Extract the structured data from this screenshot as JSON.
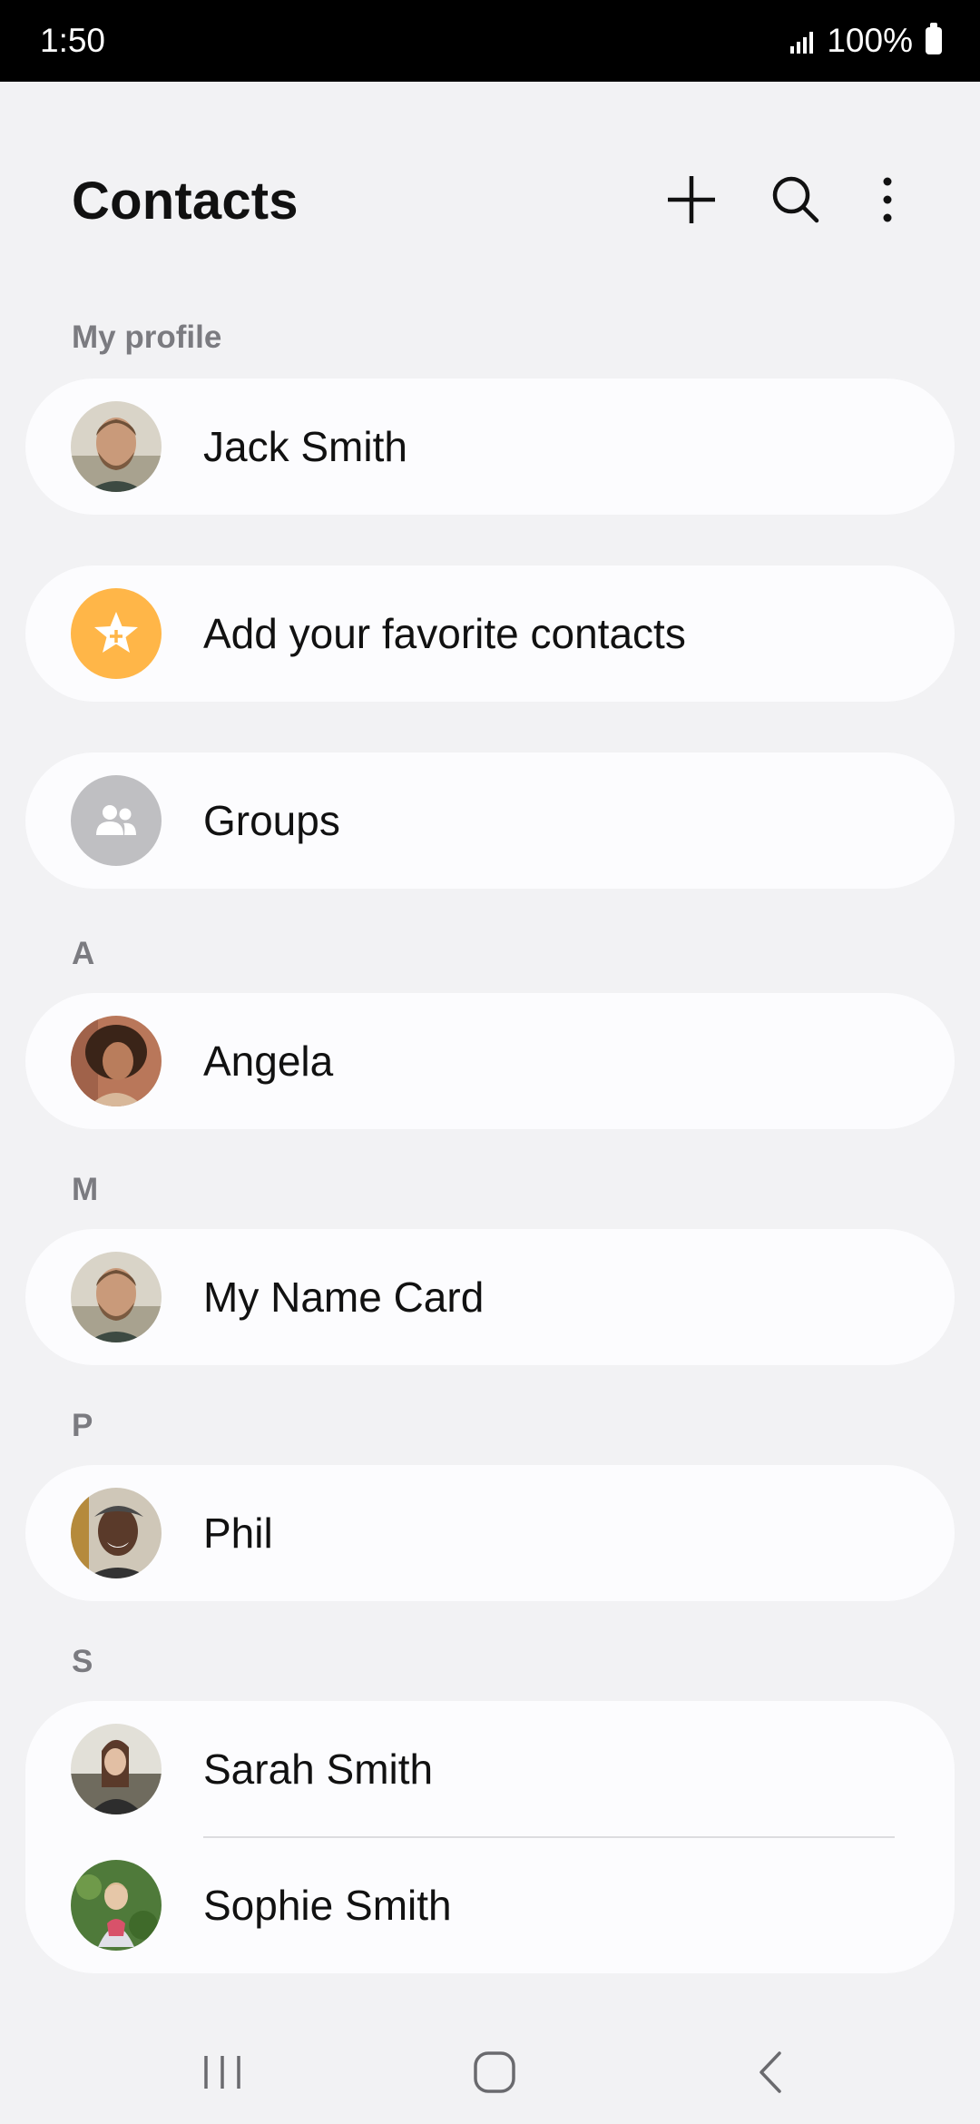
{
  "status_bar": {
    "time": "1:50",
    "battery": "100%",
    "signal_icon": "signal-icon",
    "battery_icon": "battery-icon"
  },
  "header": {
    "title": "Contacts",
    "icons": [
      "plus-icon",
      "search-icon",
      "more-vert-icon"
    ]
  },
  "sections": {
    "my_profile": "My profile",
    "a": "A",
    "m": "M",
    "p": "P",
    "s": "S"
  },
  "profile": {
    "name": "Jack Smith"
  },
  "favorites": {
    "label": "Add your favorite contacts",
    "icon": "star-plus-icon",
    "color": "#ffb648"
  },
  "groups": {
    "label": "Groups",
    "icon": "people-icon",
    "color": "#bfbfc2"
  },
  "contacts": {
    "angela": "Angela",
    "my_name_card": "My Name Card",
    "phil": "Phil",
    "sarah": "Sarah Smith",
    "sophie": "Sophie Smith"
  },
  "nav": {
    "icons": [
      "recent-apps-icon",
      "home-icon",
      "back-icon"
    ]
  },
  "colors": {
    "background": "#f2f2f4",
    "card": "#fcfcfe",
    "section_label": "#7b7b80"
  }
}
